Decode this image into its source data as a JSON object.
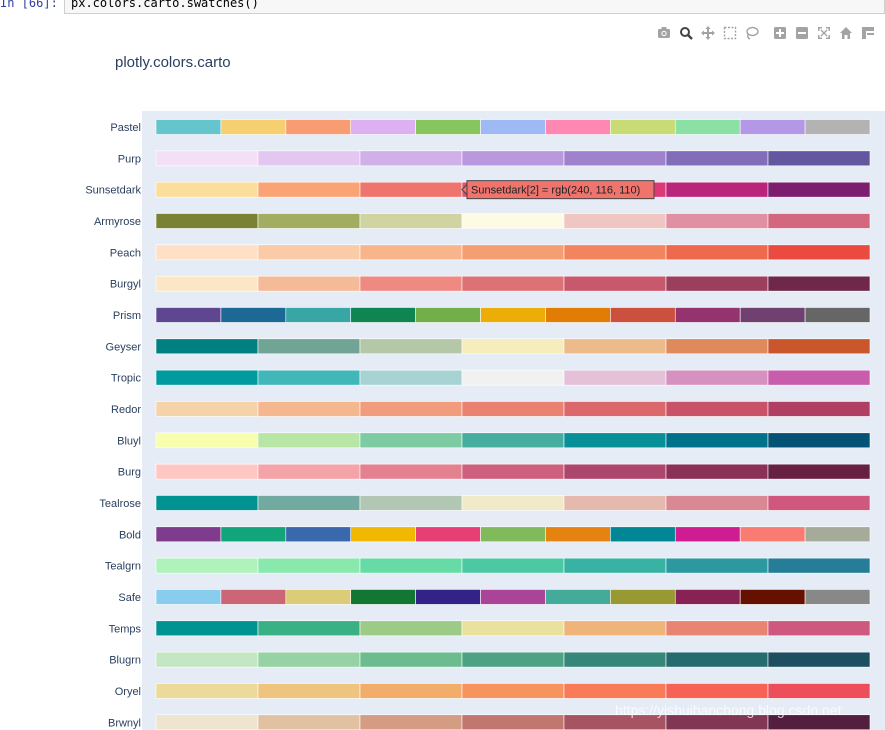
{
  "notebook": {
    "prompt": "In  [66]:",
    "code": "px.colors.carto.swatches()"
  },
  "modebar": {
    "buttons": [
      "camera-icon",
      "zoom-icon",
      "pan-icon",
      "box-select-icon",
      "lasso-icon",
      "zoom-in-icon",
      "zoom-out-icon",
      "autoscale-icon",
      "reset-axes-icon",
      "spike-lines-icon"
    ]
  },
  "chart_data": {
    "type": "swatches",
    "title": "plotly.colors.carto",
    "plot_background": "#e5ecf6",
    "rows": [
      {
        "name": "Pastel",
        "colors": [
          "#66C5CC",
          "#F6CF71",
          "#F89C74",
          "#DCB0F2",
          "#87C55F",
          "#9EB9F3",
          "#FE88B1",
          "#C9DB74",
          "#8BE0A4",
          "#B497E7",
          "#B3B3B3"
        ]
      },
      {
        "name": "Purp",
        "colors": [
          "#f3e0f7",
          "#e4c7f1",
          "#d1afe8",
          "#b998dd",
          "#9f82ce",
          "#826dba",
          "#63589f"
        ]
      },
      {
        "name": "Sunsetdark",
        "colors": [
          "#fcde9c",
          "#faa476",
          "#f0746e",
          "#e34f6f",
          "#dc3977",
          "#b9257a",
          "#7c1d6f"
        ]
      },
      {
        "name": "Armyrose",
        "colors": [
          "#798234",
          "#a3ad62",
          "#d0d3a2",
          "#fdfbe4",
          "#f0c6c3",
          "#df91a3",
          "#d46780"
        ]
      },
      {
        "name": "Peach",
        "colors": [
          "#fde0c5",
          "#facba6",
          "#f8b58b",
          "#f59e72",
          "#f2855d",
          "#ef6a4c",
          "#eb4a40"
        ]
      },
      {
        "name": "Burgyl",
        "colors": [
          "#fbe6c5",
          "#f5ba98",
          "#ee8a82",
          "#dc7176",
          "#c8586c",
          "#9c3f5d",
          "#70284a"
        ]
      },
      {
        "name": "Prism",
        "colors": [
          "#5F4690",
          "#1D6996",
          "#38A6A5",
          "#0F8554",
          "#73AF48",
          "#EDAD08",
          "#E17C05",
          "#CC503E",
          "#94346E",
          "#6F4070",
          "#666666"
        ]
      },
      {
        "name": "Geyser",
        "colors": [
          "#008080",
          "#70a494",
          "#b4c8a8",
          "#f6edbd",
          "#edbb8a",
          "#de8a5a",
          "#ca562c"
        ]
      },
      {
        "name": "Tropic",
        "colors": [
          "#009B9E",
          "#42B7B9",
          "#A7D3D4",
          "#F1F1F1",
          "#E4C1D9",
          "#D691C1",
          "#C75DAB"
        ]
      },
      {
        "name": "Redor",
        "colors": [
          "#f6d2a9",
          "#f5b78e",
          "#f19c7c",
          "#ea8171",
          "#dd686c",
          "#ca5268",
          "#b13f64"
        ]
      },
      {
        "name": "Bluyl",
        "colors": [
          "#f7feae",
          "#b7e6a5",
          "#7ccba2",
          "#46aea0",
          "#089099",
          "#00718b",
          "#045275"
        ]
      },
      {
        "name": "Burg",
        "colors": [
          "#ffc6c4",
          "#f4a3a8",
          "#e38191",
          "#cc607d",
          "#ad466c",
          "#8b3058",
          "#672044"
        ]
      },
      {
        "name": "Tealrose",
        "colors": [
          "#009392",
          "#72aaa1",
          "#b1c7b3",
          "#f1eac8",
          "#e5b9ad",
          "#d98994",
          "#d0587e"
        ]
      },
      {
        "name": "Bold",
        "colors": [
          "#7F3C8D",
          "#11A579",
          "#3969AC",
          "#F2B701",
          "#E73F74",
          "#80BA5A",
          "#E68310",
          "#008695",
          "#CF1C90",
          "#f97b72",
          "#A5AA99"
        ]
      },
      {
        "name": "Tealgrn",
        "colors": [
          "#b0f2bc",
          "#89e8ac",
          "#67dba5",
          "#4cc8a3",
          "#38b2a3",
          "#2c98a0",
          "#257d98"
        ]
      },
      {
        "name": "Safe",
        "colors": [
          "#88CCEE",
          "#CC6677",
          "#DDCC77",
          "#117733",
          "#332288",
          "#AA4499",
          "#44AA99",
          "#999933",
          "#882255",
          "#661100",
          "#888888"
        ]
      },
      {
        "name": "Temps",
        "colors": [
          "#009392",
          "#39b185",
          "#9ccb86",
          "#e9e29c",
          "#eeb479",
          "#e88471",
          "#cf597e"
        ]
      },
      {
        "name": "Blugrn",
        "colors": [
          "#c4e6c3",
          "#96d2a4",
          "#6dbc90",
          "#4da284",
          "#36877a",
          "#266b6e",
          "#1d4f60"
        ]
      },
      {
        "name": "Oryel",
        "colors": [
          "#ecda9a",
          "#efc47e",
          "#f3ad6a",
          "#f7945d",
          "#f97b57",
          "#f66356",
          "#ee4d5a"
        ]
      },
      {
        "name": "Brwnyl",
        "colors": [
          "#ede5cf",
          "#e0c2a2",
          "#d39c83",
          "#c1766f",
          "#a65461",
          "#813753",
          "#541f3f"
        ]
      }
    ],
    "hover": {
      "text": "Sunsetdark[2] = rgb(240, 116, 110)",
      "row": 2,
      "index": 2
    }
  },
  "watermark": "https://yishuihanchong.blog.csdn.net"
}
